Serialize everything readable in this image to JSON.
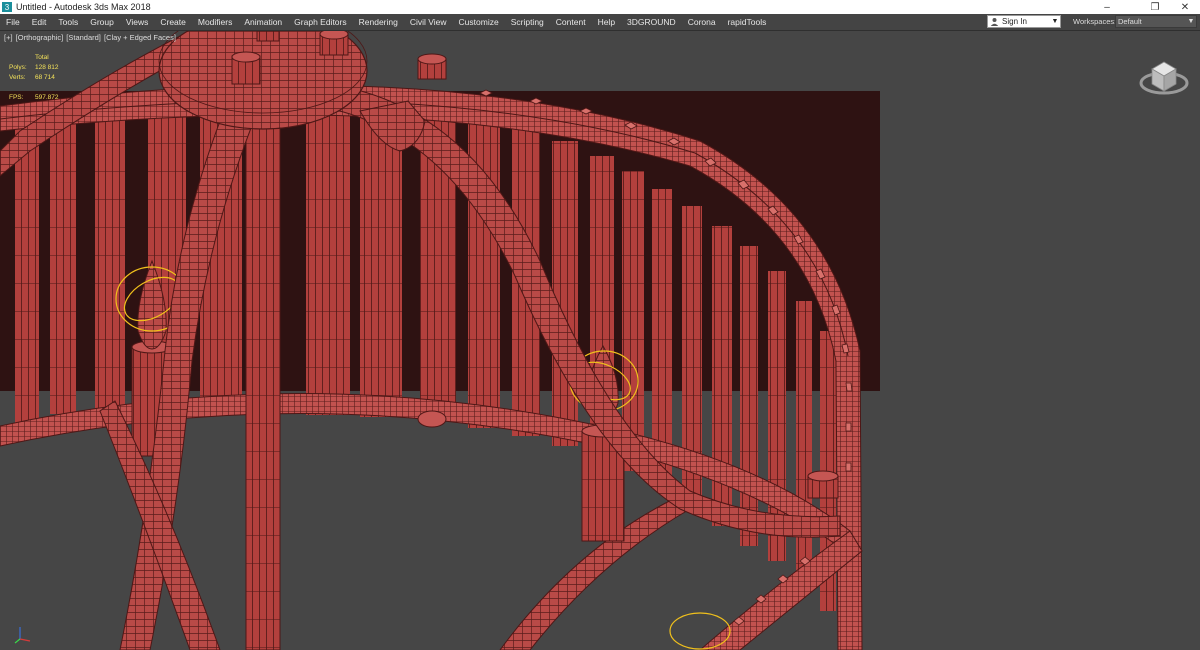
{
  "window": {
    "title": "Untitled - Autodesk 3ds Max 2018",
    "controls": {
      "minimize": "–",
      "maximize": "❐",
      "close": "✕"
    }
  },
  "menubar": {
    "items": [
      "File",
      "Edit",
      "Tools",
      "Group",
      "Views",
      "Create",
      "Modifiers",
      "Animation",
      "Graph Editors",
      "Rendering",
      "Civil View",
      "Customize",
      "Scripting",
      "Content",
      "Help",
      "3DGROUND",
      "Corona",
      "rapidTools"
    ],
    "signin_label": "Sign In",
    "workspaces_label": "Workspaces:",
    "workspace_value": "Default"
  },
  "viewport": {
    "labels": [
      "[+]",
      "[Orthographic]",
      "[Standard]",
      "[Clay + Edged Faces]"
    ],
    "stats": {
      "header": "Total",
      "polys_label": "Polys:",
      "polys_value": "128 812",
      "verts_label": "Verts:",
      "verts_value": "68 714",
      "fps_label": "FPS:",
      "fps_value": "597.872"
    }
  },
  "colors": {
    "viewport_bg": "#464646",
    "clay": "#b94a47",
    "wire": "#5a1c1b",
    "stats_text": "#f4e25a",
    "selection_gizmo": "#f0c01c"
  },
  "icons": [
    "app-icon",
    "user-icon",
    "chevron-down-icon",
    "viewcube-icon",
    "axis-tripod-icon"
  ]
}
